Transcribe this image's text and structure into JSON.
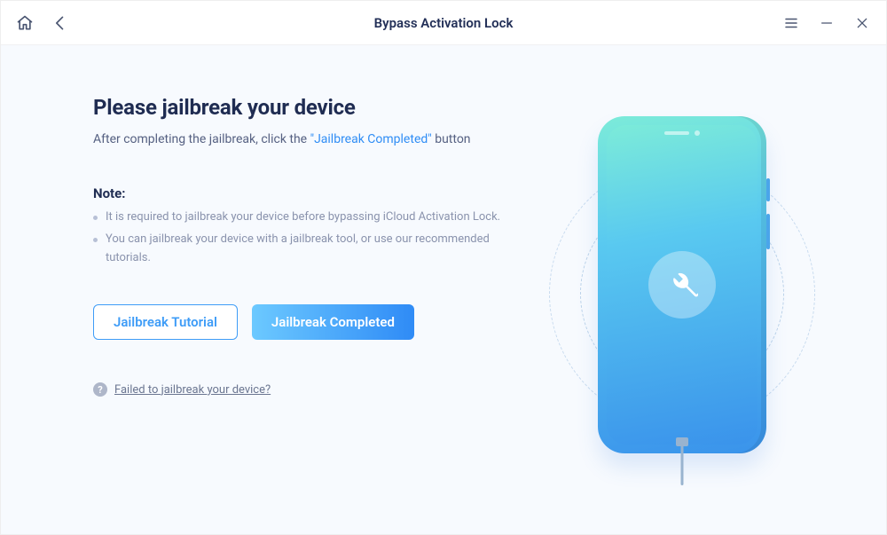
{
  "titlebar": {
    "title": "Bypass Activation Lock"
  },
  "main": {
    "heading": "Please jailbreak your device",
    "subtext_prefix": "After completing the jailbreak, click the ",
    "subtext_quoted": "\"Jailbreak Completed\"",
    "subtext_suffix": " button",
    "note_heading": "Note:",
    "notes": [
      "It is required to jailbreak your device before bypassing iCloud Activation Lock.",
      "You can jailbreak your device with a jailbreak tool, or use our recommended tutorials."
    ],
    "buttons": {
      "tutorial": "Jailbreak Tutorial",
      "completed": "Jailbreak Completed"
    },
    "help_text": "Failed to jailbreak your device?",
    "help_glyph": "?"
  }
}
